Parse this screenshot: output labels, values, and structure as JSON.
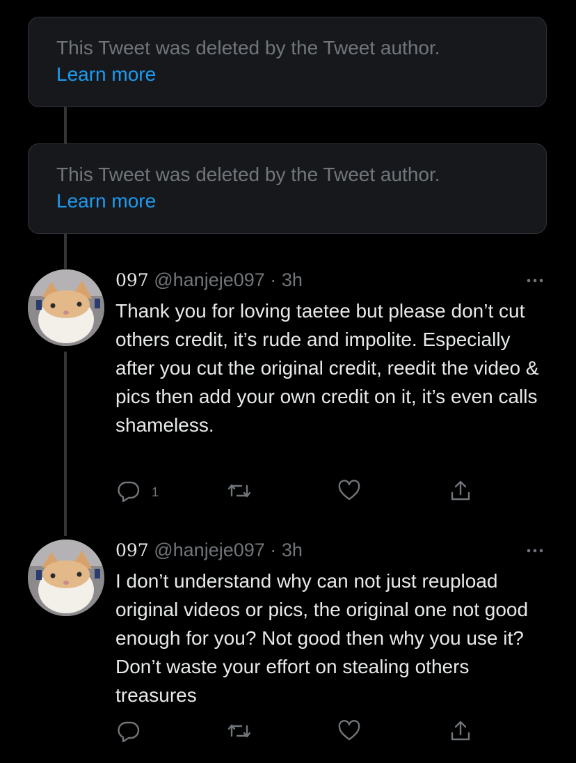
{
  "deleted_tweets": [
    {
      "message": "This Tweet was deleted by the Tweet author.",
      "link": "Learn more"
    },
    {
      "message": "This Tweet was deleted by the Tweet author.",
      "link": "Learn more"
    }
  ],
  "tweets": [
    {
      "display_name": "097",
      "handle": "@hanjeje097",
      "separator": "·",
      "time": "3h",
      "text": "Thank you for loving taetee but please don’t cut others credit, it’s rude and impolite. Especially after you cut the original credit, reedit the video & pics then add your own credit on it, it’s even calls shameless.",
      "reply_count": "1"
    },
    {
      "display_name": "097",
      "handle": "@hanjeje097",
      "separator": "·",
      "time": "3h",
      "text": "I don’t understand why can not just reupload original videos or pics, the original one not good enough for you? Not good then why you use it? Don’t waste your effort on stealing others treasures",
      "reply_count": ""
    }
  ],
  "icons": {
    "reply": "reply-icon",
    "retweet": "retweet-icon",
    "like": "like-icon",
    "share": "share-icon",
    "more": "more-icon"
  },
  "colors": {
    "background": "#000000",
    "card_background": "#16181c",
    "secondary_text": "#71767b",
    "primary_text": "#e7e9ea",
    "link": "#1d9bf0"
  }
}
